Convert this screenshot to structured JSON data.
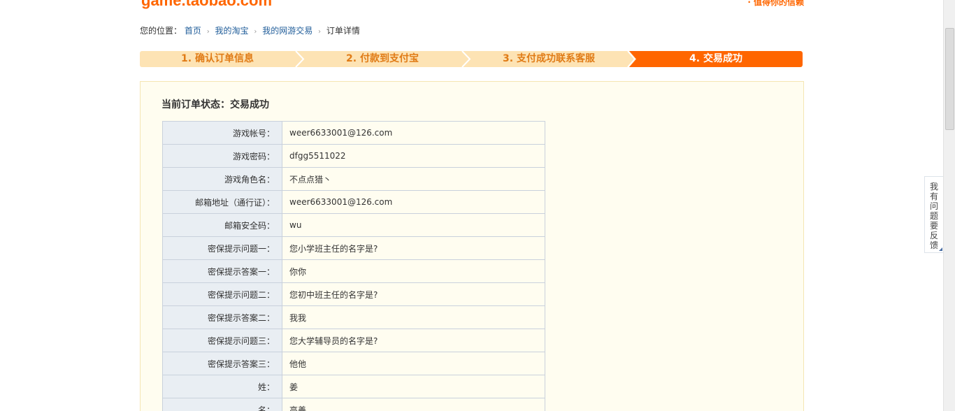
{
  "header": {
    "logo_text": "game.taobao.com",
    "slogan": "值得你的信赖"
  },
  "breadcrumb": {
    "prefix": "您的位置：",
    "items": [
      "首页",
      "我的淘宝",
      "我的网游交易"
    ],
    "current": "订单详情"
  },
  "steps": [
    {
      "label": "1. 确认订单信息"
    },
    {
      "label": "2. 付款到支付宝"
    },
    {
      "label": "3. 支付成功联系客服"
    },
    {
      "label": "4. 交易成功"
    }
  ],
  "order": {
    "status_label": "当前订单状态：交易成功",
    "rows": [
      {
        "label": "游戏帐号：",
        "value": "weer6633001@126.com"
      },
      {
        "label": "游戏密码：",
        "value": "dfgg5511022"
      },
      {
        "label": "游戏角色名：",
        "value": "不点点猎丶"
      },
      {
        "label": "邮箱地址（通行证）：",
        "value": "weer6633001@126.com"
      },
      {
        "label": "邮箱安全码：",
        "value": "wu"
      },
      {
        "label": "密保提示问题一：",
        "value": "您小学班主任的名字是?"
      },
      {
        "label": "密保提示答案一：",
        "value": "你你"
      },
      {
        "label": "密保提示问题二：",
        "value": "您初中班主任的名字是?"
      },
      {
        "label": "密保提示答案二：",
        "value": "我我"
      },
      {
        "label": "密保提示问题三：",
        "value": "您大学辅导员的名字是?"
      },
      {
        "label": "密保提示答案三：",
        "value": "他他"
      },
      {
        "label": "姓：",
        "value": "姜"
      },
      {
        "label": "名：",
        "value": "高善"
      }
    ]
  },
  "feedback": {
    "label": "我有问题要反馈"
  },
  "colors": {
    "accent": "#ff6600",
    "step_bg": "#fde3b4",
    "label_bg": "#e9eef3",
    "box_bg": "#fffdf0",
    "link": "#1f5c99"
  }
}
